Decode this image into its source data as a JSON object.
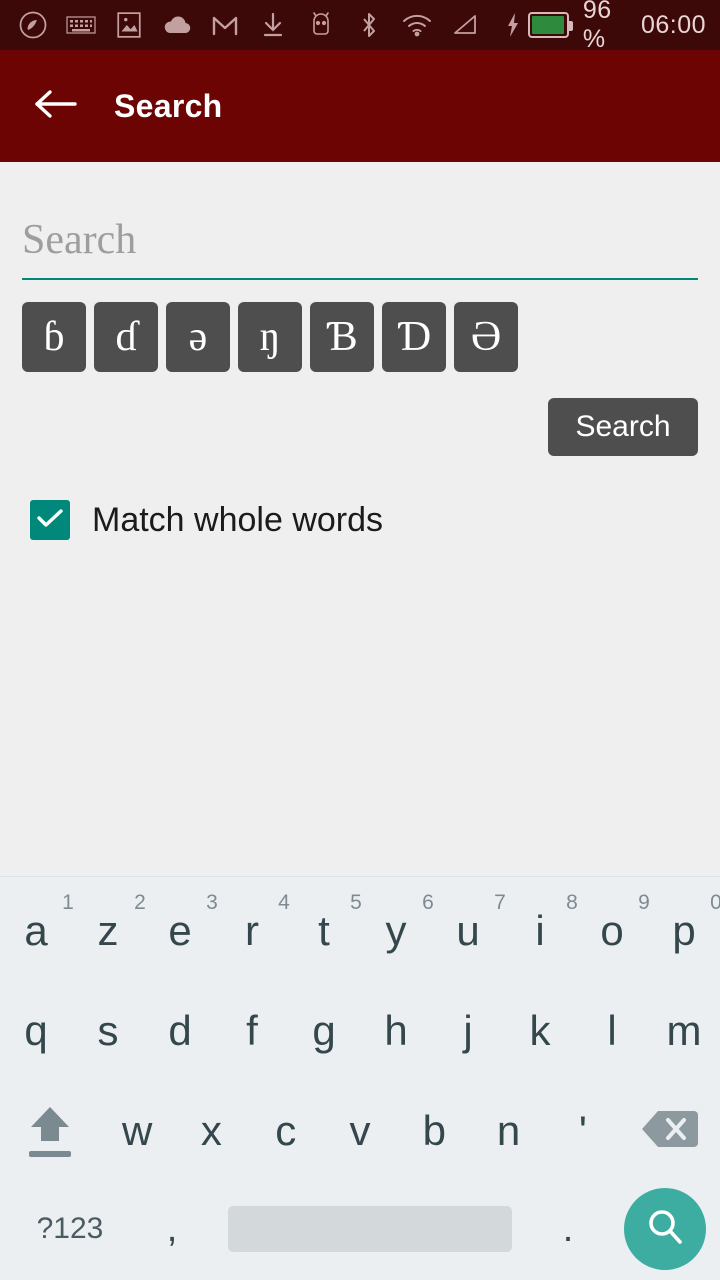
{
  "status_bar": {
    "background": "#3d0808",
    "icons": [
      {
        "name": "phoenix-app-icon"
      },
      {
        "name": "keyboard-icon"
      },
      {
        "name": "image-icon"
      },
      {
        "name": "cloud-icon"
      },
      {
        "name": "gmail-icon"
      },
      {
        "name": "download-icon"
      },
      {
        "name": "android-robot-icon"
      },
      {
        "name": "bluetooth-icon"
      },
      {
        "name": "wifi-icon"
      },
      {
        "name": "signal-icon"
      },
      {
        "name": "charging-bolt-icon"
      }
    ],
    "battery_percent": "96 %",
    "battery_level": 96,
    "battery_color": "#2e8b3e",
    "clock": "06:00"
  },
  "app_bar": {
    "background": "#6d0404",
    "back_icon": "arrow-left-icon",
    "title": "Search"
  },
  "search": {
    "placeholder": "Search",
    "value": "",
    "underline_color": "#00897b",
    "button_label": "Search"
  },
  "special_chars": [
    {
      "glyph": "ɓ",
      "name": "char-b-hook-lower"
    },
    {
      "glyph": "ɗ",
      "name": "char-d-hook-lower"
    },
    {
      "glyph": "ə",
      "name": "char-schwa-lower"
    },
    {
      "glyph": "ŋ",
      "name": "char-eng-lower"
    },
    {
      "glyph": "Ɓ",
      "name": "char-b-hook-upper"
    },
    {
      "glyph": "Ɗ",
      "name": "char-d-hook-upper"
    },
    {
      "glyph": "Ə",
      "name": "char-schwa-upper"
    }
  ],
  "options": {
    "match_whole_words_label": "Match whole words",
    "match_whole_words_checked": true,
    "checkbox_color": "#00897b"
  },
  "keyboard": {
    "layout": "azerty",
    "background": "#eceff1",
    "row1": [
      {
        "key": "a",
        "alt": "1"
      },
      {
        "key": "z",
        "alt": "2"
      },
      {
        "key": "e",
        "alt": "3"
      },
      {
        "key": "r",
        "alt": "4"
      },
      {
        "key": "t",
        "alt": "5"
      },
      {
        "key": "y",
        "alt": "6"
      },
      {
        "key": "u",
        "alt": "7"
      },
      {
        "key": "i",
        "alt": "8"
      },
      {
        "key": "o",
        "alt": "9"
      },
      {
        "key": "p",
        "alt": "0"
      }
    ],
    "row2": [
      {
        "key": "q"
      },
      {
        "key": "s"
      },
      {
        "key": "d"
      },
      {
        "key": "f"
      },
      {
        "key": "g"
      },
      {
        "key": "h"
      },
      {
        "key": "j"
      },
      {
        "key": "k"
      },
      {
        "key": "l"
      },
      {
        "key": "m"
      }
    ],
    "row3": [
      {
        "key": "w"
      },
      {
        "key": "x"
      },
      {
        "key": "c"
      },
      {
        "key": "v"
      },
      {
        "key": "b"
      },
      {
        "key": "n"
      },
      {
        "key": "'"
      }
    ],
    "shift_icon": "shift-arrow-icon",
    "delete_icon": "backspace-icon",
    "symbols_label": "?123",
    "comma_label": ",",
    "period_label": ".",
    "space_label": "",
    "action_icon": "search-icon",
    "action_color": "#3cada0"
  }
}
